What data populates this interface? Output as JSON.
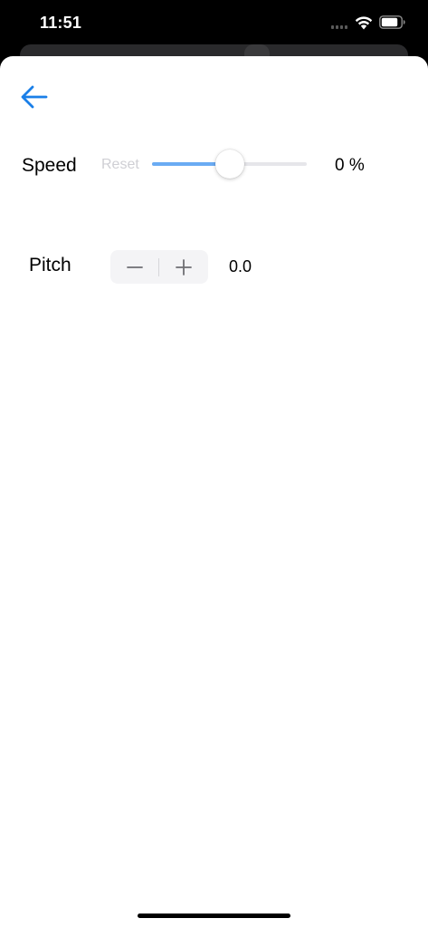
{
  "status_bar": {
    "time": "11:51",
    "icons": [
      "cellular-signal-icon",
      "wifi-icon",
      "battery-icon"
    ]
  },
  "nav": {
    "back_icon": "arrow-left-icon"
  },
  "speed": {
    "label": "Speed",
    "reset_label": "Reset",
    "value_text": "0 %",
    "slider_fraction": 0.5
  },
  "pitch": {
    "label": "Pitch",
    "decrement_icon": "minus-icon",
    "increment_icon": "plus-icon",
    "value_text": "0.0"
  },
  "colors": {
    "accent": "#1a7fe8",
    "slider_fill": "#6aabf3",
    "slider_track": "#e6e6ea",
    "reset_text": "#cfcfd4",
    "stepper_bg": "#f4f4f6"
  }
}
